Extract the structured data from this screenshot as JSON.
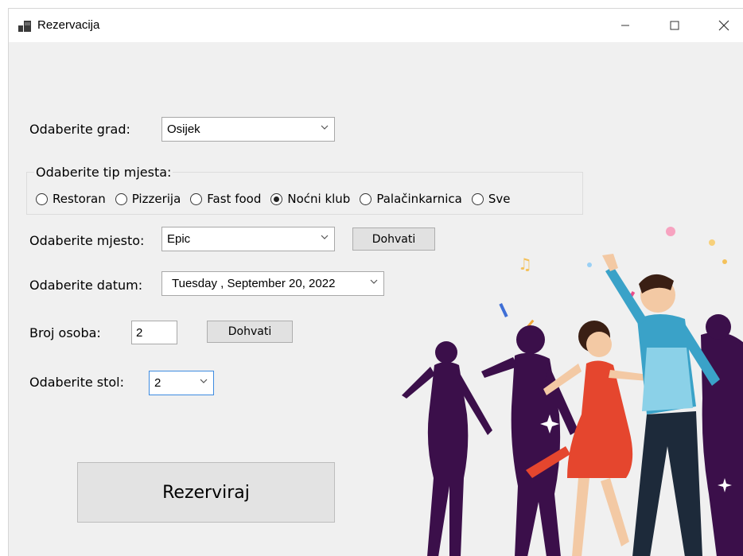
{
  "window": {
    "title": "Rezervacija"
  },
  "form": {
    "grad": {
      "label": "Odaberite grad:",
      "value": "Osijek"
    },
    "tip": {
      "label": "Odaberite tip mjesta:",
      "options": [
        "Restoran",
        "Pizzerija",
        "Fast food",
        "Noćni klub",
        "Palačinkarnica",
        "Sve"
      ],
      "selected": "Noćni klub"
    },
    "mjesto": {
      "label": "Odaberite mjesto:",
      "value": "Epic",
      "fetch_label": "Dohvati"
    },
    "datum": {
      "label": "Odaberite datum:",
      "value": "Tuesday   , September 20, 2022"
    },
    "osobe": {
      "label": "Broj osoba:",
      "value": "2",
      "fetch_label": "Dohvati"
    },
    "stol": {
      "label": "Odaberite stol:",
      "value": "2"
    },
    "submit_label": "Rezerviraj"
  },
  "colors": {
    "window_bg": "#f0f0f0",
    "focus_border": "#3d8be0"
  },
  "icons": {
    "app": "windows-form-icon",
    "minimize": "minimize-icon",
    "maximize": "maximize-icon",
    "close": "close-icon",
    "dropdown": "chevron-down-icon"
  }
}
